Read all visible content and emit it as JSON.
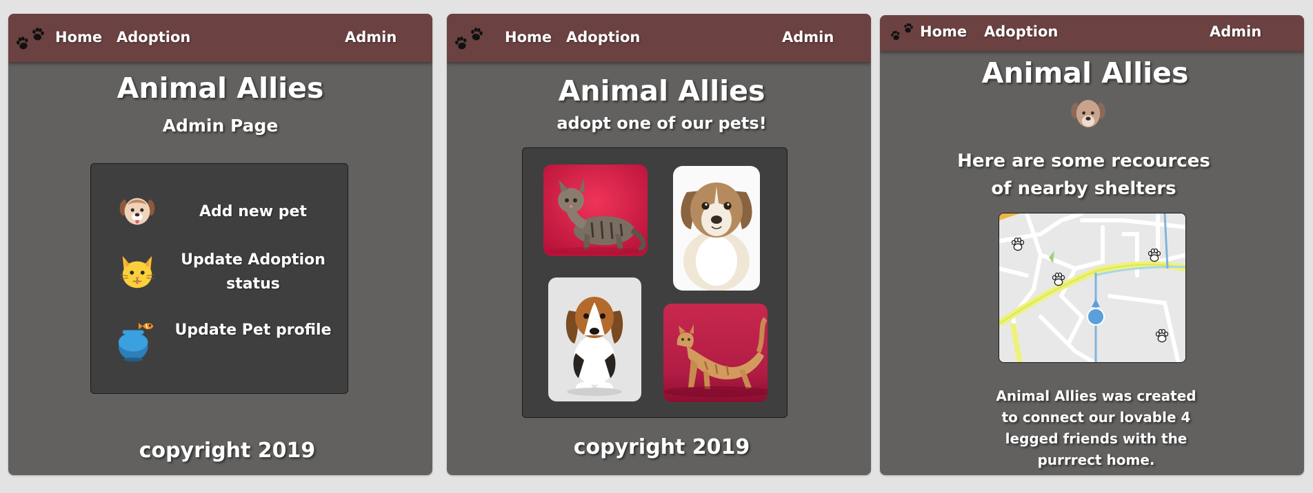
{
  "nav": {
    "home": "Home",
    "adoption": "Adoption",
    "admin": "Admin"
  },
  "admin_page": {
    "title": "Animal Allies",
    "subtitle": "Admin Page",
    "menu": [
      {
        "label": "Add new pet",
        "icon": "dog-icon"
      },
      {
        "label": "Update Adoption status",
        "icon": "cat-icon"
      },
      {
        "label": "Update Pet profile",
        "icon": "fishbowl-icon"
      }
    ],
    "footer": "copyright 2019"
  },
  "adoption_page": {
    "title": "Animal Allies",
    "subtitle": "adopt one of our pets!",
    "pets": [
      {
        "name": "tabby-cat-photo"
      },
      {
        "name": "fluffy-puppy-photo"
      },
      {
        "name": "beagle-puppy-photo"
      },
      {
        "name": "orange-cat-photo"
      }
    ],
    "footer": "copyright 2019"
  },
  "resources_page": {
    "title": "Animal Allies",
    "heading_line1": "Here are some recources",
    "heading_line2": "of nearby shelters",
    "about_lines": [
      "Animal Allies was created",
      "to connect our lovable 4",
      "legged friends with the",
      "purrrect home."
    ]
  },
  "colors": {
    "page_background": "#e3e3e3",
    "panel": "#626160",
    "navbar": "#6b4141",
    "card": "#403f3f",
    "text": "#ffffff"
  },
  "icons": [
    "paw-icon",
    "dog-icon",
    "cat-icon",
    "fishbowl-icon",
    "map-pin-icon",
    "location-dot-icon"
  ]
}
